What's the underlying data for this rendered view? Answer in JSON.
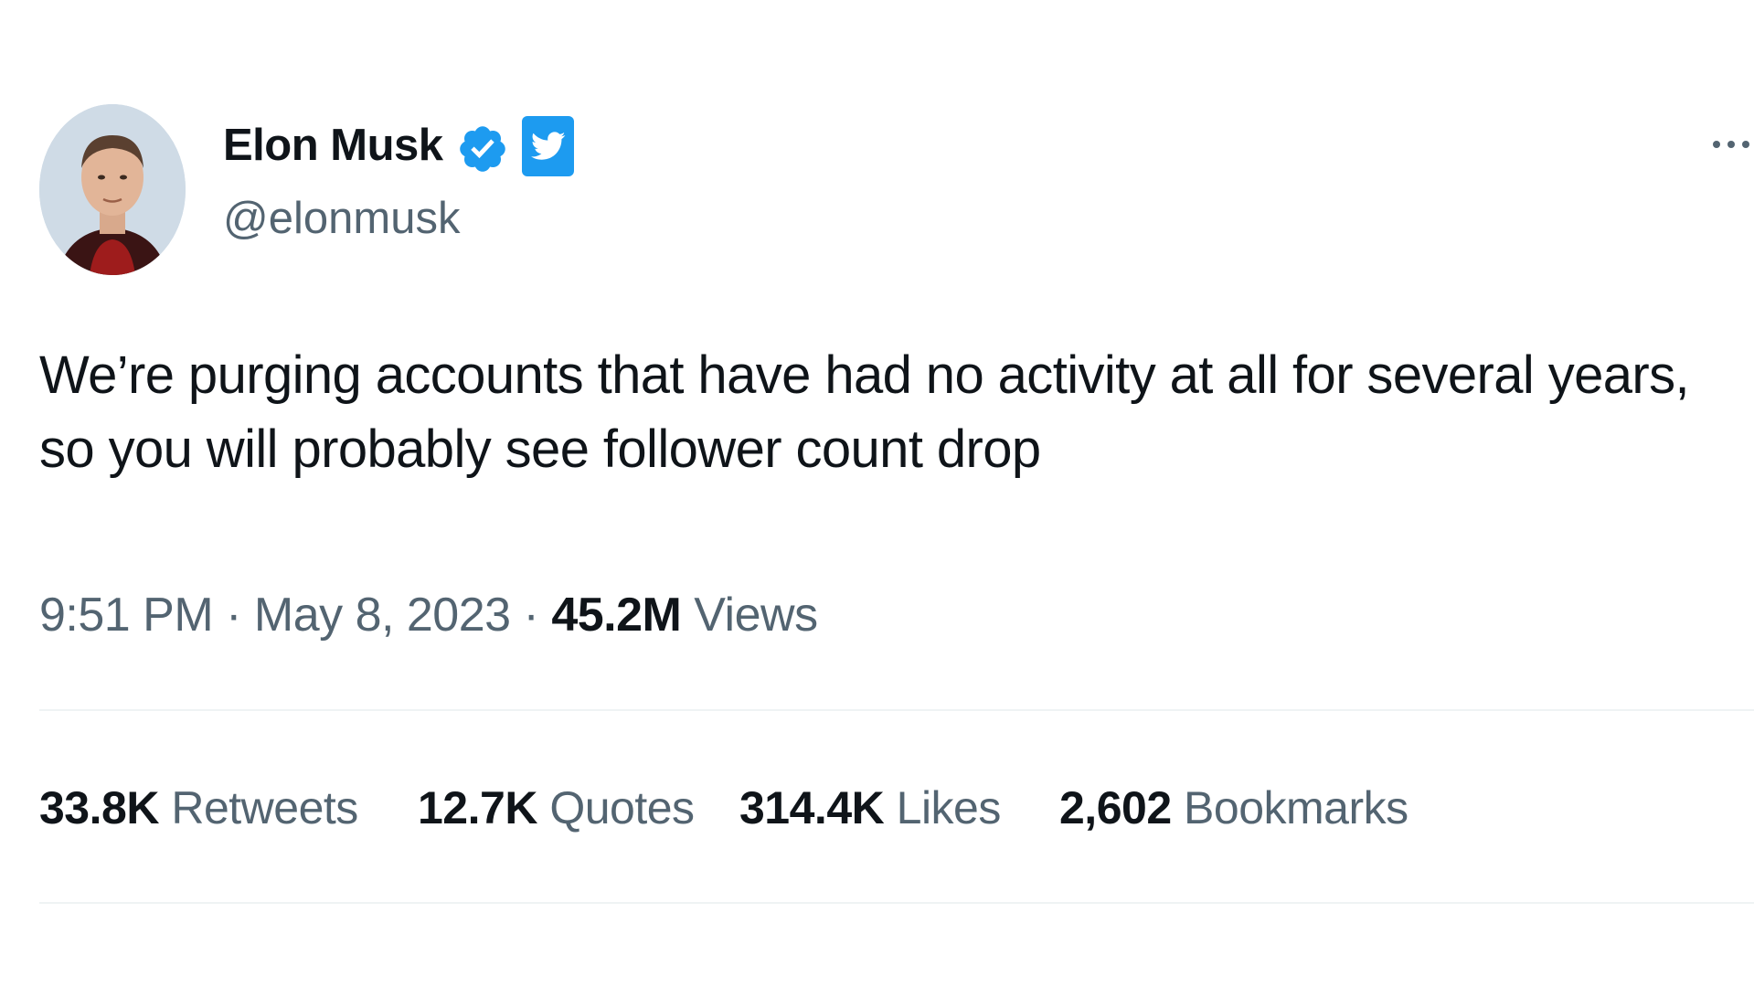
{
  "author": {
    "name": "Elon Musk",
    "handle": "@elonmusk"
  },
  "tweet": {
    "text_line1": "We’re purging accounts that have had no activity at all for several years,",
    "text_line2": "so you will probably see follower count drop"
  },
  "meta": {
    "time": "9:51 PM",
    "separator": "·",
    "date": "May 8, 2023",
    "views_count": "45.2M",
    "views_label": "Views"
  },
  "stats": {
    "retweets_count": "33.8K",
    "retweets_label": "Retweets",
    "quotes_count": "12.7K",
    "quotes_label": "Quotes",
    "likes_count": "314.4K",
    "likes_label": "Likes",
    "bookmarks_count": "2,602",
    "bookmarks_label": "Bookmarks"
  },
  "colors": {
    "accent": "#1d9bf0",
    "text_primary": "#0f1419",
    "text_secondary": "#536471",
    "divider": "#eff3f4"
  },
  "icons": {
    "verified": "verified-badge-icon",
    "twitter": "twitter-bird-icon",
    "more": "more-options-icon"
  }
}
